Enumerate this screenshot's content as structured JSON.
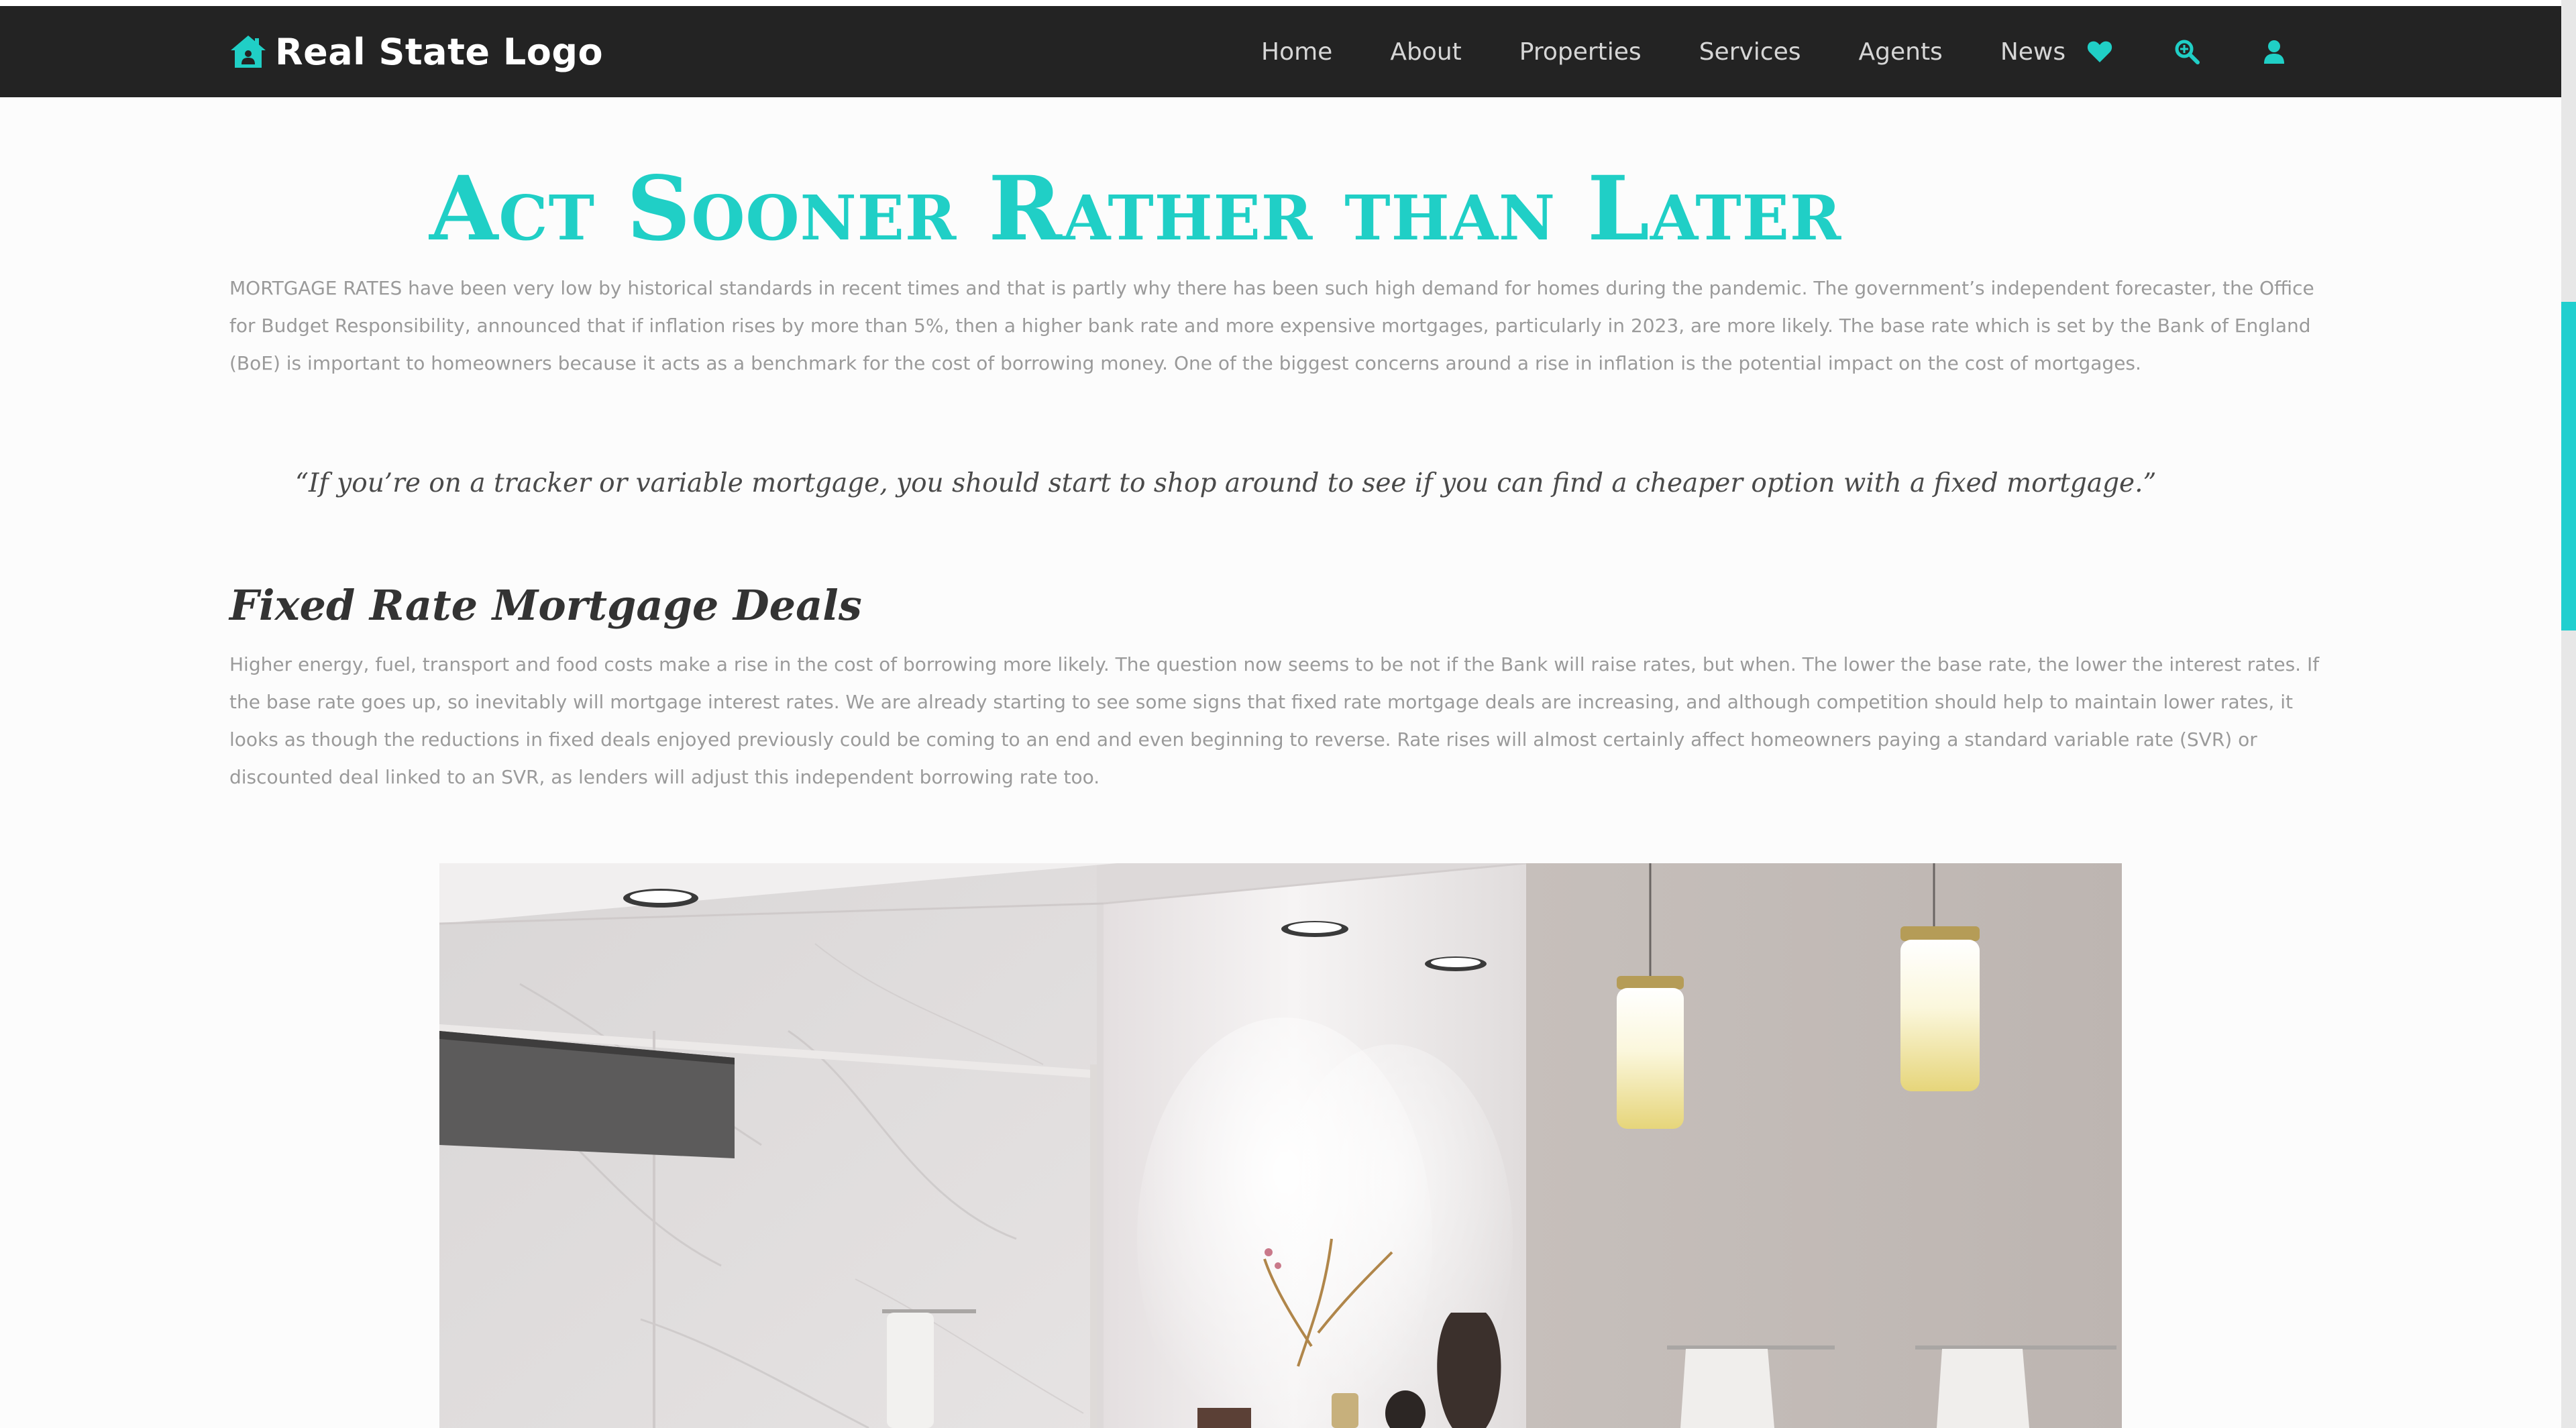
{
  "nav": {
    "logo_text": "Real State Logo",
    "logo_icon": "house-icon",
    "links": [
      "Home",
      "About",
      "Properties",
      "Services",
      "Agents",
      "News"
    ],
    "icons": [
      "heart-icon",
      "search-icon",
      "user-icon"
    ]
  },
  "article": {
    "title": "Act Sooner Rather than Later",
    "paragraph_1": "MORTGAGE RATES have been very low by historical standards in recent times and that is partly why there has been such high demand for homes during the pandemic. The government’s independent forecaster, the Office for Budget Responsibility, announced that if inflation rises by more than 5%, then a higher bank rate and more expensive mortgages, particularly in 2023, are more likely. The base rate which is set by the Bank of England (BoE) is important to homeowners because it acts as a benchmark for the cost of borrowing money. One of the biggest concerns around a rise in inflation is the potential impact on the cost of mortgages.",
    "quote": "“If you’re on a tracker or variable mortgage, you should start to shop around to see if you can find a cheaper option with a fixed mortgage.”",
    "subheading": "Fixed Rate Mortgage Deals",
    "paragraph_2": "Higher energy, fuel, transport and food costs make a rise in the cost of borrowing more likely. The question now seems to be not if the Bank will raise rates, but when. The lower the base rate, the lower the interest rates. If the base rate goes up, so inevitably will mortgage interest rates. We are already starting to see some signs that fixed rate mortgage deals are increasing, and although competition should help to maintain lower rates, it looks as though the reductions in fixed deals enjoyed previously could be coming to an end and even beginning to reverse. Rate rises will almost certainly affect homeowners paying a standard variable rate (SVR) or discounted deal linked to an SVR, as lenders will adjust this independent borrowing rate too."
  },
  "colors": {
    "accent": "#20cfc6",
    "navbar_bg": "#232323",
    "body_text": "#9a9a9a"
  }
}
